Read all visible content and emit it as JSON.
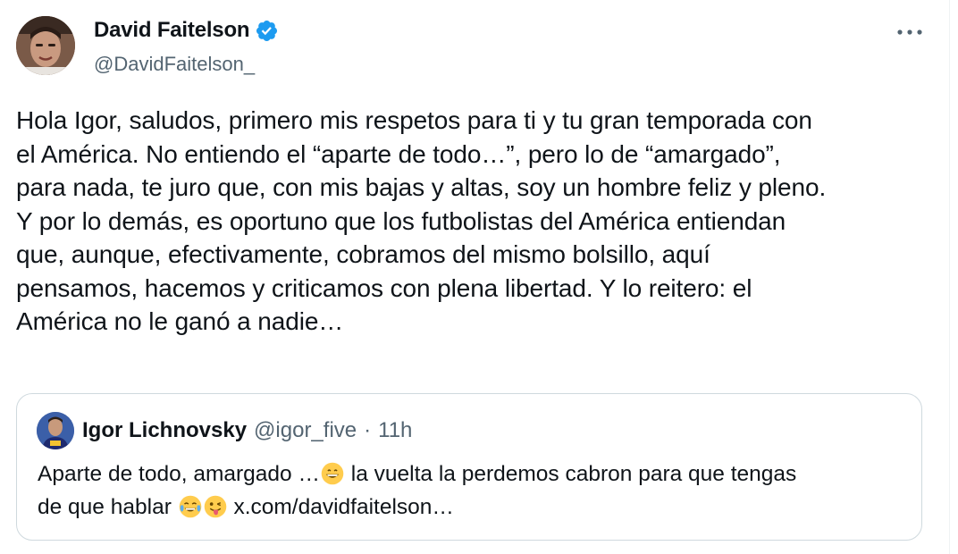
{
  "tweet": {
    "author": {
      "name": "David Faitelson",
      "handle": "@DavidFaitelson_",
      "verified": true
    },
    "more_icon": "more-horizontal-icon",
    "text_lines": [
      "Hola Igor, saludos, primero mis respetos para ti y tu gran temporada con",
      "el América. No entiendo el “aparte de todo…”, pero lo de “amargado”,",
      "para nada, te juro que, con mis bajas y altas, soy un hombre feliz y pleno.",
      "Y por lo demás, es oportuno que los futbolistas del América entiendan",
      "que, aunque, efectivamente, cobramos del mismo bolsillo, aquí",
      "pensamos, hacemos y criticamos con plena libertad. Y lo reitero: el",
      "América no le ganó a nadie…"
    ],
    "colors": {
      "verified_badge": "#1d9bf0",
      "secondary_text": "#536471",
      "border": "#cfd9de"
    }
  },
  "quoted_tweet": {
    "author_name": "Igor Lichnovsky",
    "handle": "@igor_five",
    "separator": "·",
    "time": "11h",
    "line1_a": "Aparte de todo, amargado …",
    "line1_emoji": "grinning-face-emoji",
    "line1_b": " la vuelta la perdemos cabron para que tengas",
    "line2_a": "de que hablar ",
    "line2_emojis": [
      "tears-of-joy-emoji",
      "winking-tongue-emoji"
    ],
    "line2_b": " x.com/davidfaitelson…"
  }
}
